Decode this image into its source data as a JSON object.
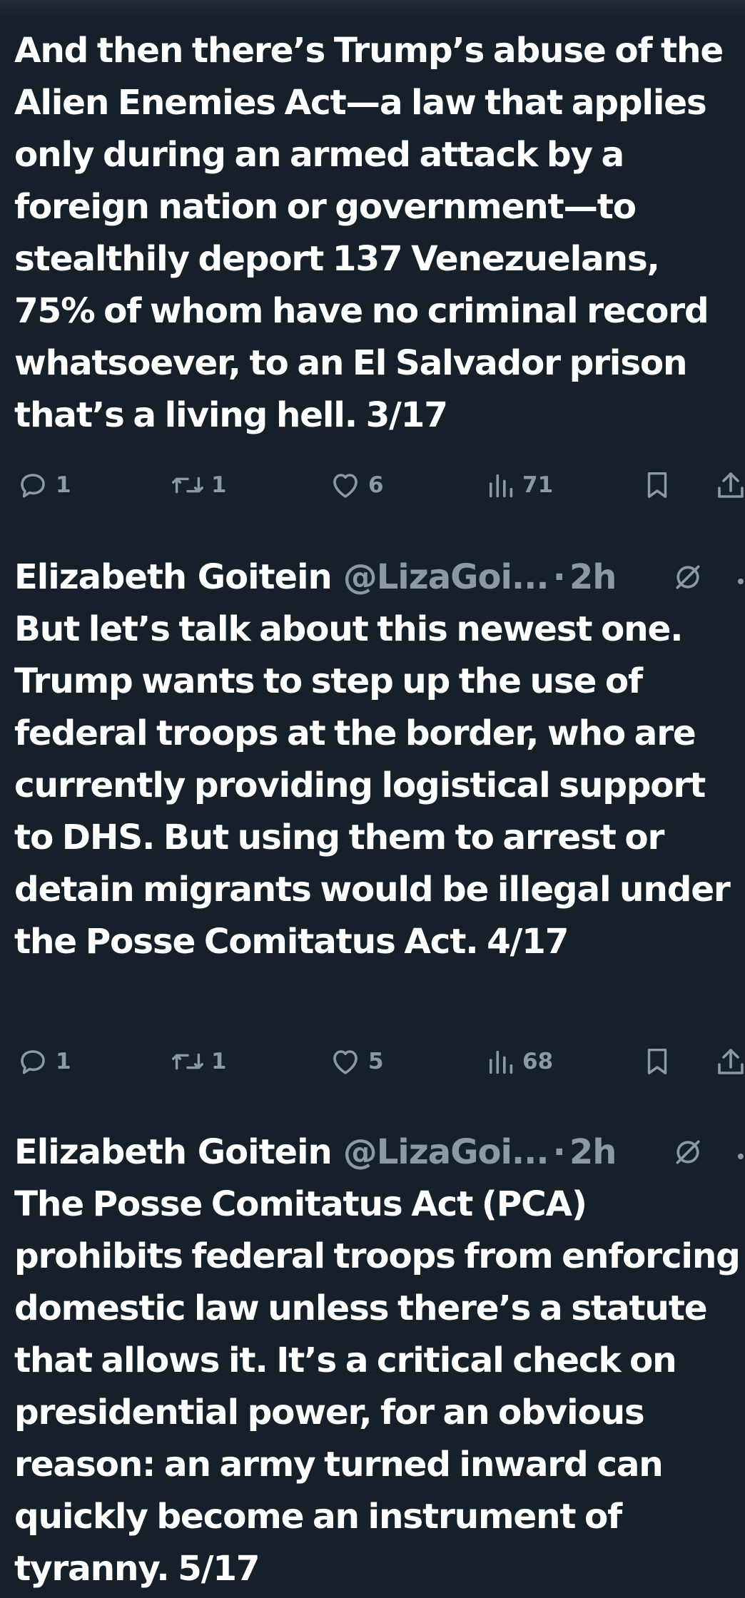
{
  "tweets": [
    {
      "text": "And then there’s Trump’s abuse of the Alien Enemies Act—a law that applies only during an armed attack by a foreign nation or government—to stealthily deport 137 Venezuelans, 75% of whom have no criminal record whatsoever, to an El Salvador prison that’s a living hell. 3/17",
      "replies": "1",
      "reposts": "1",
      "likes": "6",
      "views": "71"
    },
    {
      "name": "Elizabeth Goitein",
      "handle": "@LizaGoi...",
      "separator": "·",
      "time": "2h",
      "text": "But let’s talk about this newest one. Trump wants to step up the use of federal troops at the border, who are currently providing logistical support to DHS. But using them to arrest or detain migrants would be illegal under the Posse Comitatus Act. 4/17",
      "replies": "1",
      "reposts": "1",
      "likes": "5",
      "views": "68"
    },
    {
      "name": "Elizabeth Goitein",
      "handle": "@LizaGoi...",
      "separator": "·",
      "time": "2h",
      "text": "The Posse Comitatus Act (PCA) prohibits federal troops from enforcing domestic law unless there’s a statute that allows it. It’s a critical check on presidential power, for an obvious reason: an army turned inward can quickly become an instrument of tyranny. 5/17"
    }
  ]
}
